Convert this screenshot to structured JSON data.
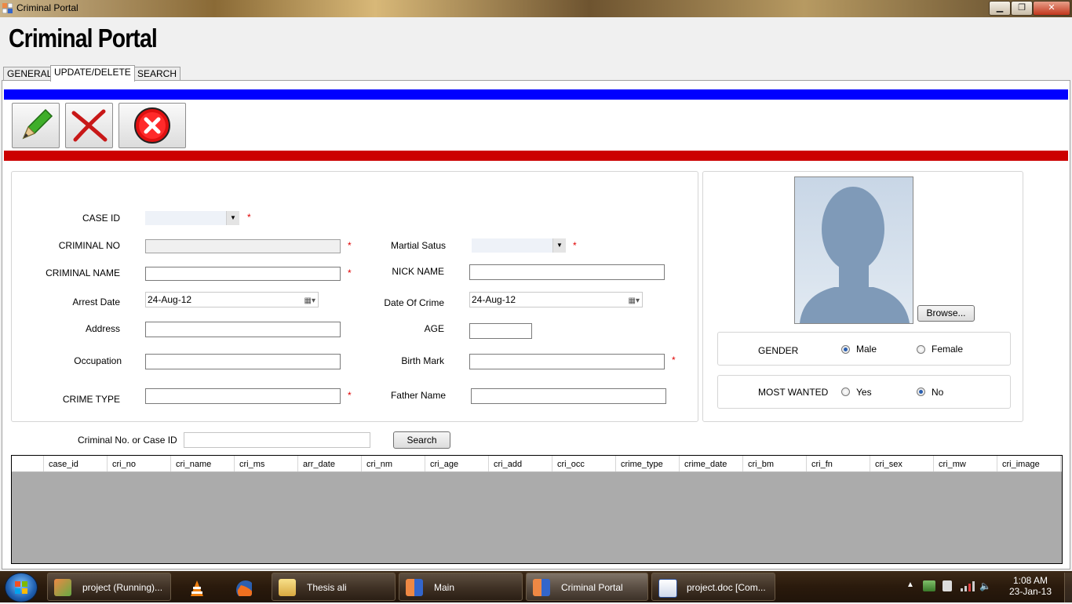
{
  "window": {
    "title": "Criminal Portal"
  },
  "header": {
    "title": "Criminal Portal"
  },
  "tabs": [
    {
      "label": "GENERAL"
    },
    {
      "label": "UPDATE/DELETE"
    },
    {
      "label": "SEARCH"
    }
  ],
  "form": {
    "case_id": {
      "label": "CASE ID",
      "value": ""
    },
    "criminal_no": {
      "label": "CRIMINAL NO",
      "value": ""
    },
    "criminal_name": {
      "label": "CRIMINAL NAME",
      "value": ""
    },
    "arrest_date": {
      "label": "Arrest Date",
      "value": "24-Aug-12"
    },
    "address": {
      "label": "Address",
      "value": ""
    },
    "occupation": {
      "label": "Occupation",
      "value": ""
    },
    "crime_type": {
      "label": "CRIME TYPE",
      "value": ""
    },
    "martial_status": {
      "label": "Martial Satus",
      "value": ""
    },
    "nick_name": {
      "label": "NICK NAME",
      "value": ""
    },
    "date_of_crime": {
      "label": "Date Of Crime",
      "value": "24-Aug-12"
    },
    "age": {
      "label": "AGE",
      "value": ""
    },
    "birth_mark": {
      "label": "Birth Mark",
      "value": ""
    },
    "father_name": {
      "label": "Father Name",
      "value": ""
    },
    "required_mark": "*"
  },
  "photo": {
    "browse_label": "Browse..."
  },
  "gender": {
    "label": "GENDER",
    "options": [
      "Male",
      "Female"
    ],
    "selected": "Male"
  },
  "most_wanted": {
    "label": "MOST WANTED",
    "options": [
      "Yes",
      "No"
    ],
    "selected": "No"
  },
  "search": {
    "label": "Criminal No. or Case ID",
    "value": "",
    "button_label": "Search"
  },
  "grid": {
    "columns": [
      "case_id",
      "cri_no",
      "cri_name",
      "cri_ms",
      "arr_date",
      "cri_nm",
      "cri_age",
      "cri_add",
      "cri_occ",
      "crime_type",
      "crime_date",
      "cri_bm",
      "cri_fn",
      "cri_sex",
      "cri_mw",
      "cri_image"
    ],
    "rows": []
  },
  "taskbar": {
    "items": [
      {
        "label": "project (Running)..."
      },
      {
        "label": ""
      },
      {
        "label": ""
      },
      {
        "label": "Thesis ali"
      },
      {
        "label": "Main"
      },
      {
        "label": "Criminal Portal"
      },
      {
        "label": "project.doc [Com..."
      }
    ],
    "time": "1:08 AM",
    "date": "23-Jan-13"
  },
  "colors": {
    "blue_bar": "#0000ff",
    "red_bar": "#cc0000",
    "grid_bg": "#ababab"
  }
}
